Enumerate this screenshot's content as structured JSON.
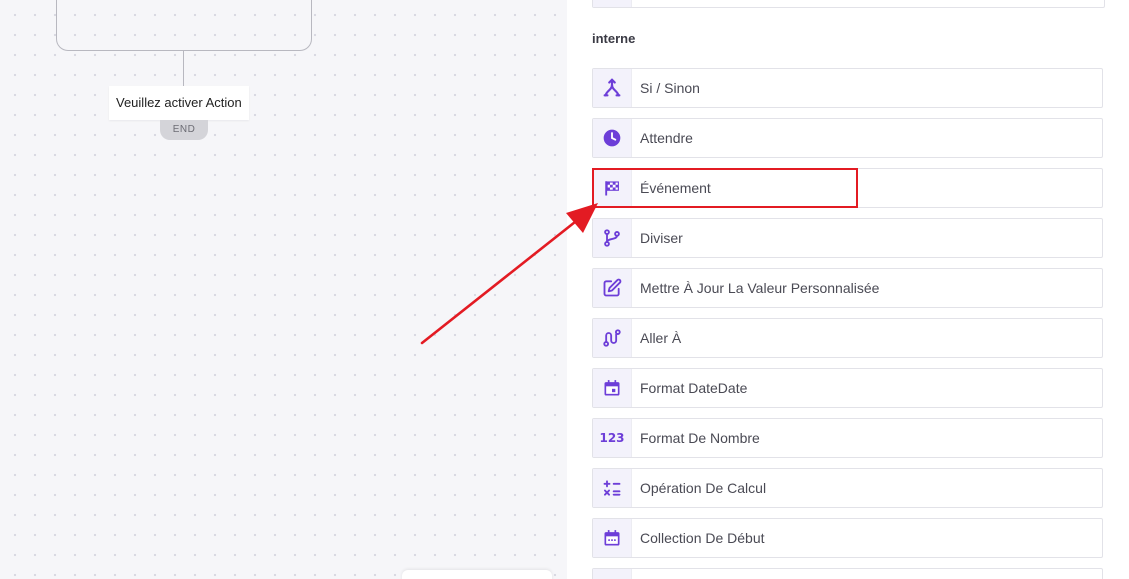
{
  "canvas": {
    "tooltip": "Veuillez activer Action",
    "end_label": "END"
  },
  "panel": {
    "section_title": "interne",
    "items": [
      {
        "label": "Si / Sinon",
        "icon": "branch-merge-icon"
      },
      {
        "label": "Attendre",
        "icon": "clock-icon"
      },
      {
        "label": "Événement",
        "icon": "checkered-flag-icon"
      },
      {
        "label": "Diviser",
        "icon": "split-branch-icon"
      },
      {
        "label": "Mettre À Jour La Valeur Personnalisée",
        "icon": "edit-icon"
      },
      {
        "label": "Aller À",
        "icon": "route-icon"
      },
      {
        "label": "Format DateDate",
        "icon": "calendar-event-icon"
      },
      {
        "label": "Format De Nombre",
        "icon": "numbers-icon",
        "glyph": "123"
      },
      {
        "label": "Opération De Calcul",
        "icon": "calculator-operators-icon"
      },
      {
        "label": "Collection De Début",
        "icon": "calendar-icon"
      }
    ]
  },
  "colors": {
    "accent": "#6d3ed8",
    "highlight": "#e31b23"
  }
}
